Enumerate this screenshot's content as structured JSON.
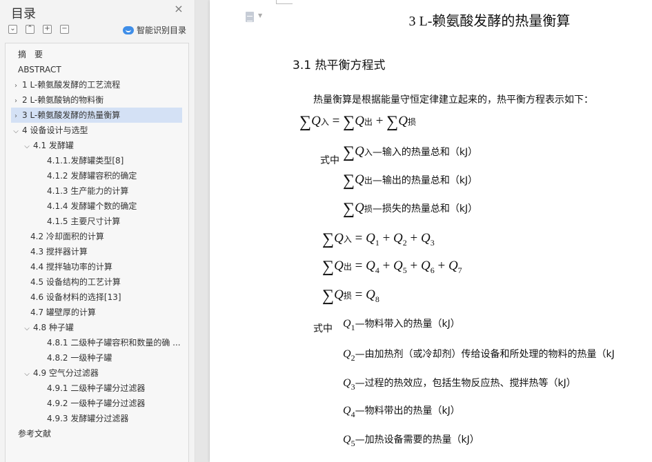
{
  "sidebar": {
    "title": "目录",
    "smart_toc_label": "智能识别目录",
    "toc": [
      {
        "label": "摘　要",
        "level": 0,
        "caret": ""
      },
      {
        "label": "ABSTRACT",
        "level": 0,
        "caret": ""
      },
      {
        "label": "1 L-赖氨酸发酵的工艺流程",
        "level": 0,
        "caret": ">"
      },
      {
        "label": "2 L-赖氨酸钠的物料衡",
        "level": 0,
        "caret": ">"
      },
      {
        "label": "3 L-赖氨酸发酵的热量衡算",
        "level": 0,
        "caret": ">",
        "selected": true
      },
      {
        "label": "4  设备设计与选型",
        "level": 0,
        "caret": "v"
      },
      {
        "label": "4.1  发酵罐",
        "level": 1,
        "caret": "v"
      },
      {
        "label": "4.1.1.发酵罐类型[8]",
        "level": 2,
        "caret": ""
      },
      {
        "label": "4.1.2  发酵罐容积的确定",
        "level": 2,
        "caret": ""
      },
      {
        "label": "4.1.3  生产能力的计算",
        "level": 2,
        "caret": ""
      },
      {
        "label": "4.1.4  发酵罐个数的确定",
        "level": 2,
        "caret": ""
      },
      {
        "label": "4.1.5  主要尺寸计算",
        "level": 2,
        "caret": ""
      },
      {
        "label": "4.2  冷却面积的计算",
        "level": 1,
        "caret": ""
      },
      {
        "label": "4.3  搅拌器计算",
        "level": 1,
        "caret": ""
      },
      {
        "label": "4.4  搅拌轴功率的计算",
        "level": 1,
        "caret": ""
      },
      {
        "label": "4.5  设备结构的工艺计算",
        "level": 1,
        "caret": ""
      },
      {
        "label": "4.6  设备材料的选择[13]",
        "level": 1,
        "caret": ""
      },
      {
        "label": "4.7 罐壁厚的计算",
        "level": 1,
        "caret": ""
      },
      {
        "label": "4.8  种子罐",
        "level": 1,
        "caret": "v"
      },
      {
        "label": "4.8.1  二级种子罐容积和数量的确 ...",
        "level": 2,
        "caret": ""
      },
      {
        "label": "4.8.2  一级种子罐",
        "level": 2,
        "caret": ""
      },
      {
        "label": "4.9  空气分过滤器",
        "level": 1,
        "caret": "v"
      },
      {
        "label": "4.9.1  二级种子罐分过滤器",
        "level": 2,
        "caret": ""
      },
      {
        "label": "4.9.2  一级种子罐分过滤器",
        "level": 2,
        "caret": ""
      },
      {
        "label": "4.9.3  发酵罐分过滤器",
        "level": 2,
        "caret": ""
      },
      {
        "label": "参考文献",
        "level": 0,
        "caret": ""
      }
    ]
  },
  "document": {
    "chapter_title": "3 L-赖氨酸发酵的热量衡算",
    "section_title": "3.1  热平衡方程式",
    "intro": "热量衡算是根据能量守恒定律建立起来的，热平衡方程表示如下：",
    "eq_main": {
      "q": "Q",
      "in": "入",
      "out": "出",
      "loss": "损",
      "eq": "=",
      "plus": "+"
    },
    "where_label": "式中",
    "def_in": "—输入的热量总和（kJ）",
    "def_out": "—输出的热量总和（kJ）",
    "def_loss": "—损失的热量总和（kJ）",
    "eq_in_rhs": [
      "1",
      "2",
      "3"
    ],
    "eq_out_rhs": [
      "4",
      "5",
      "6",
      "7"
    ],
    "eq_loss_rhs": [
      "8"
    ],
    "q_defs": [
      {
        "n": "1",
        "text": "—物料带入的热量（kJ）"
      },
      {
        "n": "2",
        "text": "—由加热剂（或冷却剂）传给设备和所处理的物料的热量（kJ"
      },
      {
        "n": "3",
        "text": "—过程的热效应，包括生物反应热、搅拌热等（kJ）"
      },
      {
        "n": "4",
        "text": "—物料带出的热量（kJ）"
      },
      {
        "n": "5",
        "text": "—加热设备需要的热量（kJ）"
      }
    ]
  },
  "colors": {
    "selected_bg": "#d4e1f5",
    "accent": "#3f8ee8"
  }
}
